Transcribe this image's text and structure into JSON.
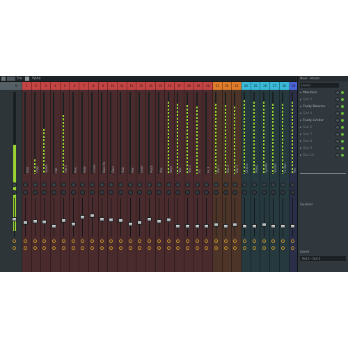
{
  "toolbar": {
    "menu_label": "Tra",
    "mode_label": "Wide"
  },
  "groups": [
    {
      "name": "master",
      "color": "#556066",
      "start": 0,
      "count": 1
    },
    {
      "name": "red-group",
      "color": "#c44343",
      "start": 1,
      "count": 16
    },
    {
      "name": "red-group-2",
      "color": "#c44343",
      "start": 17,
      "count": 4
    },
    {
      "name": "orange-group",
      "color": "#e07b2a",
      "start": 21,
      "count": 3
    },
    {
      "name": "cyan-group",
      "color": "#38b9d8",
      "start": 24,
      "count": 5
    },
    {
      "name": "blue-group",
      "color": "#4a63d6",
      "start": 29,
      "count": 1
    },
    {
      "name": "yellow-group",
      "color": "#e6b522",
      "start": 30,
      "count": 1
    }
  ],
  "colors": {
    "red_body": "#4a2b2d",
    "orange_body": "#4c3428",
    "cyan_body": "#26393f",
    "blue_body": "#2a2e46",
    "yellow_body": "#3e3a26",
    "master_body": "#2e3539",
    "meter_green": "#9ad431",
    "meter_yellow": "#e0e13a"
  },
  "strips": [
    {
      "num": "M",
      "name": "",
      "level": 0.62,
      "fader": 0.45
    },
    {
      "num": "1",
      "name": "Kick",
      "level": 0.0,
      "fader": 0.35
    },
    {
      "num": "2",
      "name": "Clap",
      "level": 0.18,
      "fader": 0.38
    },
    {
      "num": "3",
      "name": "Snare",
      "level": 0.55,
      "fader": 0.36
    },
    {
      "num": "4",
      "name": "Hat",
      "level": 0.0,
      "fader": 0.25
    },
    {
      "num": "5",
      "name": "Hat 2",
      "level": 0.72,
      "fader": 0.4
    },
    {
      "num": "6",
      "name": "Perc",
      "level": 0.0,
      "fader": 0.3
    },
    {
      "num": "7",
      "name": "Ride",
      "level": 0.0,
      "fader": 0.5
    },
    {
      "num": "8",
      "name": "Crash",
      "level": 0.0,
      "fader": 0.55
    },
    {
      "num": "9",
      "name": "Bass Fx",
      "level": 0.0,
      "fader": 0.45
    },
    {
      "num": "10",
      "name": "Bass",
      "level": 0.0,
      "fader": 0.42
    },
    {
      "num": "11",
      "name": "Sub",
      "level": 0.0,
      "fader": 0.4
    },
    {
      "num": "12",
      "name": "Pad",
      "level": 0.0,
      "fader": 0.3
    },
    {
      "num": "13",
      "name": "Lead",
      "level": 0.0,
      "fader": 0.35
    },
    {
      "num": "14",
      "name": "Pluck",
      "level": 0.0,
      "fader": 0.45
    },
    {
      "num": "15",
      "name": "Arp",
      "level": 0.0,
      "fader": 0.38
    },
    {
      "num": "16",
      "name": "Keys",
      "level": 0.88,
      "fader": 0.42
    },
    {
      "num": "17",
      "name": "Vox",
      "level": 0.86,
      "fader": 0.25
    },
    {
      "num": "18",
      "name": "Vox 2",
      "level": 0.84,
      "fader": 0.25
    },
    {
      "num": "19",
      "name": "Fx",
      "level": 0.82,
      "fader": 0.25
    },
    {
      "num": "20",
      "name": "Fx 2",
      "level": 0.0,
      "fader": 0.25
    },
    {
      "num": "21",
      "name": "Bus 1",
      "level": 0.86,
      "fader": 0.28
    },
    {
      "num": "22",
      "name": "Bus 2",
      "level": 0.84,
      "fader": 0.25
    },
    {
      "num": "23",
      "name": "Bus 3",
      "level": 0.82,
      "fader": 0.28
    },
    {
      "num": "24",
      "name": "Drums",
      "level": 0.9,
      "fader": 0.25
    },
    {
      "num": "25",
      "name": "Music",
      "level": 0.88,
      "fader": 0.25
    },
    {
      "num": "26",
      "name": "Synths",
      "level": 0.88,
      "fader": 0.28
    },
    {
      "num": "27",
      "name": "Vocals",
      "level": 0.86,
      "fader": 0.25
    },
    {
      "num": "28",
      "name": "Fx Bus",
      "level": 0.86,
      "fader": 0.25
    },
    {
      "num": "29",
      "name": "Rev",
      "level": 0.88,
      "fader": 0.25
    },
    {
      "num": "30",
      "name": "Delay",
      "level": 0.0,
      "fader": 0.25
    }
  ],
  "side_panel": {
    "title": "Mixer - Master",
    "preset": "(none)",
    "slots": [
      {
        "label": "Maximus",
        "active": true
      },
      {
        "label": "Slot 2",
        "active": false
      },
      {
        "label": "Fruity Balance",
        "active": true
      },
      {
        "label": "Slot 4",
        "active": false
      },
      {
        "label": "Fruity Limiter",
        "active": true
      },
      {
        "label": "Slot 6",
        "active": false
      },
      {
        "label": "Slot 7",
        "active": false
      },
      {
        "label": "Slot 8",
        "active": false
      },
      {
        "label": "Slot 9",
        "active": false
      },
      {
        "label": "Slot 10",
        "active": false
      }
    ],
    "eq_label": "Equalizer",
    "out_label": "(none)",
    "out_value": "Out 1 - Out 2"
  }
}
